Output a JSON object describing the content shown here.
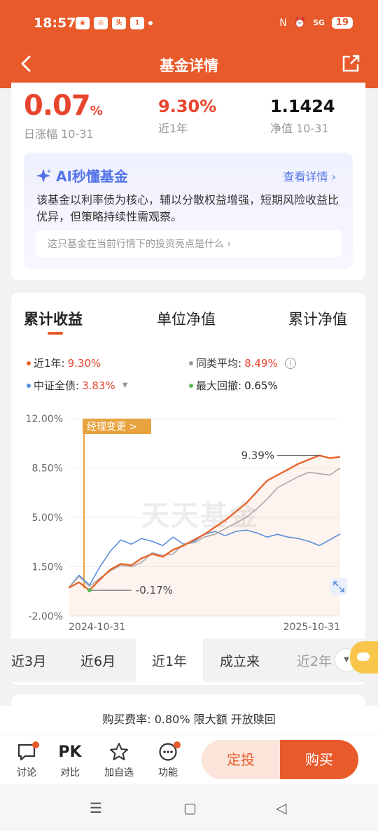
{
  "status": {
    "time": "18:57",
    "network": "5G",
    "battery": "19",
    "app_icons": [
      "wechat",
      "browser",
      "toutiao",
      "news-100"
    ]
  },
  "nav": {
    "title": "基金详情",
    "back_icon": "chevron-left-icon",
    "share_icon": "share-icon"
  },
  "stats": {
    "daily_change_value": "0.07",
    "daily_change_unit": "%",
    "daily_change_label": "日涨幅 10-31",
    "year_return_value": "9.30%",
    "year_return_label": "近1年",
    "nav_value": "1.1424",
    "nav_label": "净值 10-31"
  },
  "ai": {
    "title": "AI秒懂基金",
    "more": "查看详情",
    "summary": "该基金以利率债为核心，辅以分散权益增强，短期风险收益比优异，但策略持续性需观察。",
    "question": "这只基金在当前行情下的投资亮点是什么"
  },
  "chart": {
    "tabs": [
      "累计收益",
      "单位净值",
      "累计净值"
    ],
    "active_tab": "累计收益",
    "legend": {
      "this_fund_label": "近1年:",
      "this_fund_value": "9.30%",
      "peer_avg_label": "同类平均:",
      "peer_avg_value": "8.49%",
      "benchmark_label": "中证全债:",
      "benchmark_value": "3.83%",
      "max_drawdown_label": "最大回撤:",
      "max_drawdown_value": "0.65%"
    },
    "watermark": "天天基金",
    "manager_change_label": "经理变更 >",
    "colors": {
      "fund": "#e8662e",
      "peer": "#aaaaaa",
      "benchmark": "#5b8fdc",
      "drawdown": "#5cb85c"
    }
  },
  "chart_data": {
    "type": "line",
    "x_start": "2024-10-31",
    "x_end": "2025-10-31",
    "yticks": [
      "12.00%",
      "8.50%",
      "5.00%",
      "1.50%",
      "-2.00%"
    ],
    "ylim": [
      -2.0,
      12.0
    ],
    "annotations": [
      {
        "text": "9.39%",
        "y": 9.39
      },
      {
        "text": "-0.17%",
        "y": -0.17
      }
    ],
    "series": [
      {
        "name": "近1年",
        "values": [
          0.0,
          0.4,
          -0.17,
          0.6,
          1.3,
          1.7,
          1.6,
          2.1,
          2.4,
          2.2,
          2.7,
          3.0,
          3.4,
          3.8,
          4.3,
          4.8,
          5.4,
          6.0,
          6.8,
          7.6,
          8.0,
          8.4,
          8.8,
          9.1,
          9.39,
          9.2,
          9.3
        ]
      },
      {
        "name": "同类平均",
        "values": [
          0.0,
          0.8,
          0.1,
          0.7,
          1.2,
          1.6,
          1.5,
          1.8,
          2.5,
          2.3,
          2.4,
          3.1,
          3.2,
          3.6,
          3.8,
          4.2,
          4.6,
          5.0,
          5.6,
          6.3,
          7.1,
          7.5,
          7.9,
          8.2,
          8.1,
          8.0,
          8.49
        ]
      },
      {
        "name": "中证全债",
        "values": [
          0.0,
          0.9,
          0.2,
          1.5,
          2.6,
          3.4,
          3.1,
          3.5,
          3.3,
          3.0,
          3.6,
          3.1,
          3.3,
          3.8,
          4.0,
          3.7,
          4.0,
          4.1,
          3.9,
          3.6,
          3.8,
          3.6,
          3.5,
          3.3,
          3.0,
          3.4,
          3.83
        ]
      }
    ]
  },
  "ranges": {
    "items": [
      "近3月",
      "近6月",
      "近1年",
      "成立来",
      "近2年"
    ],
    "active": "近1年"
  },
  "bottom": {
    "fee_text": "购买费率: 0.80% 限大额 开放赎回",
    "actions": [
      {
        "label": "讨论",
        "icon": "chat-icon"
      },
      {
        "label": "对比",
        "icon": "pk-icon",
        "text": "PK"
      },
      {
        "label": "加自选",
        "icon": "star-icon"
      },
      {
        "label": "功能",
        "icon": "more-icon"
      }
    ],
    "sip_label": "定投",
    "buy_label": "购买"
  }
}
